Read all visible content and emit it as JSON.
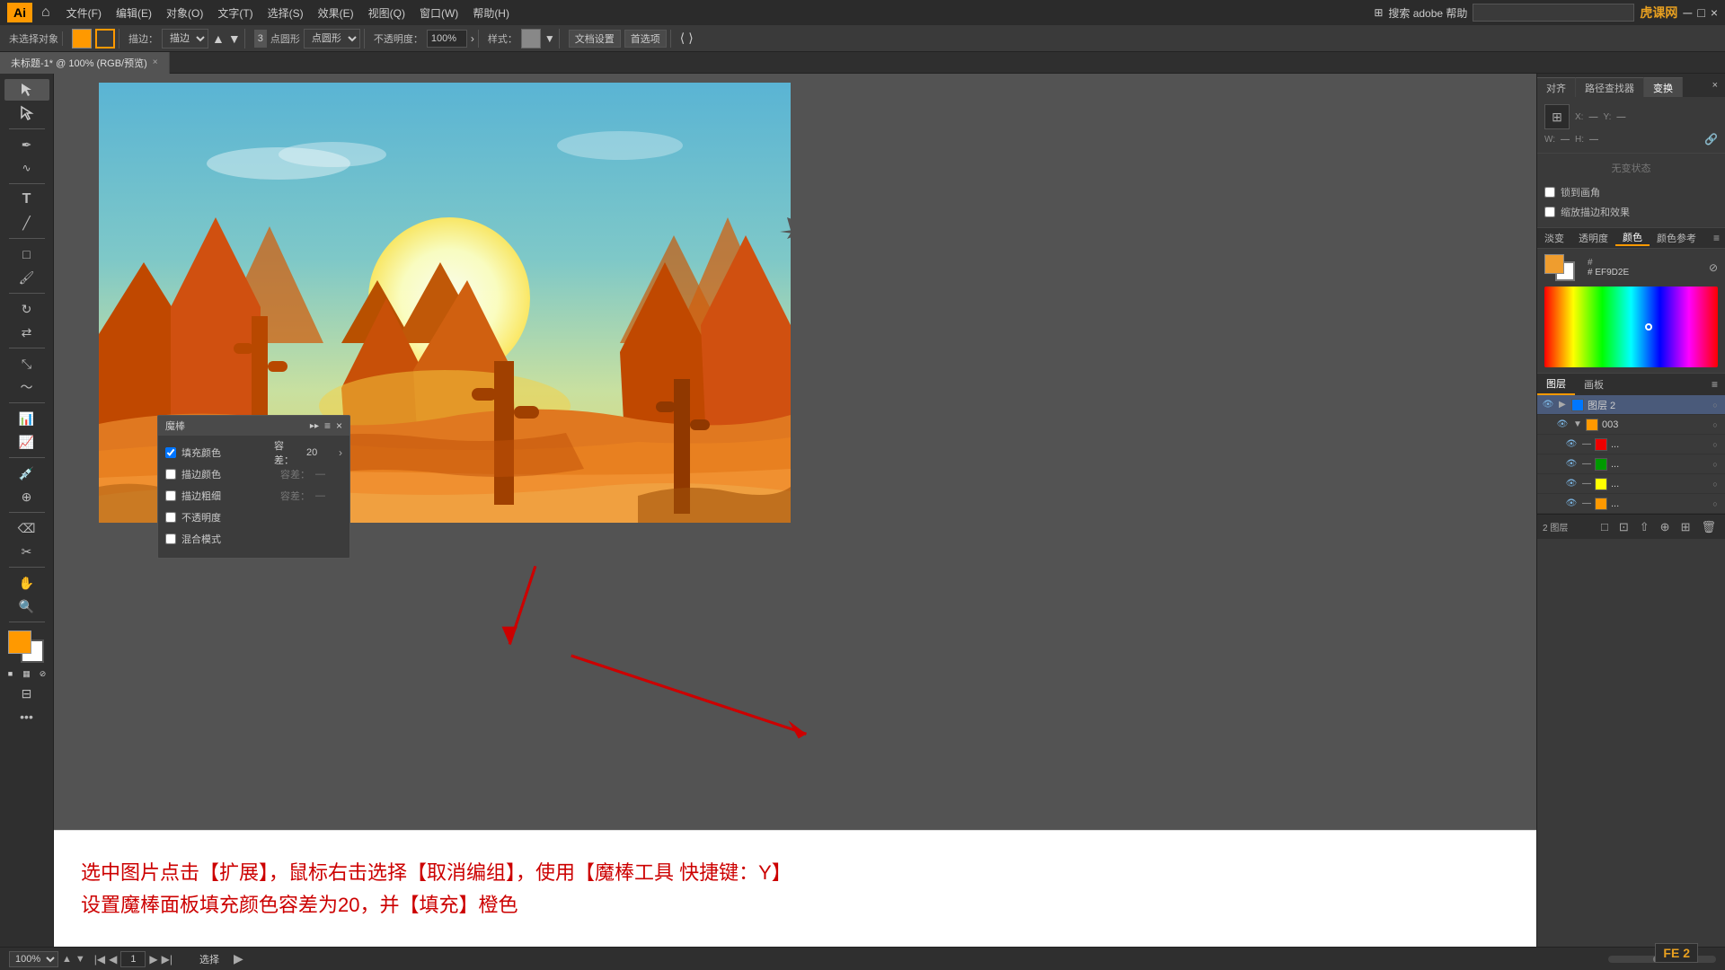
{
  "app": {
    "title": "Adobe Illustrator",
    "logo": "Ai",
    "tab_title": "未标题-1* @ 100% (RGB/预览)",
    "zoom": "100%"
  },
  "menu": {
    "items": [
      "文件(F)",
      "编辑(E)",
      "对象(O)",
      "文字(T)",
      "选择(S)",
      "效果(E)",
      "视图(Q)",
      "窗口(W)",
      "帮助(H)"
    ]
  },
  "toolbar": {
    "no_selection": "未选择对象",
    "blend_mode": "描边：",
    "brush_size": "3",
    "shape": "点圆形",
    "opacity_label": "不透明度：",
    "opacity_value": "100%",
    "style_label": "样式：",
    "doc_settings": "文档设置",
    "preferences": "首选项"
  },
  "magic_wand_panel": {
    "title": "魔棒",
    "fill_color_label": "填充颜色",
    "fill_color_checked": true,
    "tolerance_label": "容差：",
    "tolerance_value": "20",
    "stroke_color_label": "描边颜色",
    "stroke_color_checked": false,
    "stroke_weight_label": "描边粗细",
    "stroke_weight_checked": false,
    "opacity_label": "不透明度",
    "opacity_checked": false,
    "blend_mode_label": "混合模式",
    "blend_mode_checked": false
  },
  "right_panel": {
    "tabs": [
      "对齐",
      "路径查找器",
      "变换"
    ],
    "active_tab": "变换",
    "no_status_text": "无变状态",
    "checkbox1": "锁到画角",
    "checkbox2": "缩放描边和效果",
    "close_btn": "×",
    "sub_tabs": [
      "淡变",
      "透明度",
      "颜色",
      "颜色参考"
    ],
    "active_sub": "颜色",
    "hex_label": "# EF9D2E",
    "color_swatch_color": "#EF9D2E"
  },
  "layers_panel": {
    "tabs": [
      "图层",
      "画板"
    ],
    "active_tab": "图层",
    "layers": [
      {
        "name": "图层 2",
        "expanded": true,
        "visible": true,
        "active": true,
        "color": "blue"
      },
      {
        "name": "003",
        "expanded": false,
        "visible": true,
        "active": false,
        "color": "orange"
      },
      {
        "name": "...",
        "expanded": false,
        "visible": true,
        "active": false,
        "color": "red"
      },
      {
        "name": "...",
        "expanded": false,
        "visible": true,
        "active": false,
        "color": "green"
      },
      {
        "name": "...",
        "expanded": false,
        "visible": true,
        "active": false,
        "color": "yellow"
      },
      {
        "name": "...",
        "expanded": false,
        "visible": true,
        "active": false,
        "color": "orange"
      }
    ],
    "layer_count": "2 图层",
    "bottom_buttons": [
      "new-layer",
      "delete-layer",
      "move-up",
      "move-down",
      "make-clip",
      "release-clip",
      "merge"
    ]
  },
  "instruction": {
    "line1": "选中图片点击【扩展】，鼠标右击选择【取消编组】，使用【魔棒工具 快捷键：Y】",
    "line2": "设置魔棒面板填充颜色容差为20，并【填充】橙色"
  },
  "status_bar": {
    "zoom": "100%",
    "page": "1",
    "select_mode": "选择",
    "fe2_badge": "FE 2"
  }
}
